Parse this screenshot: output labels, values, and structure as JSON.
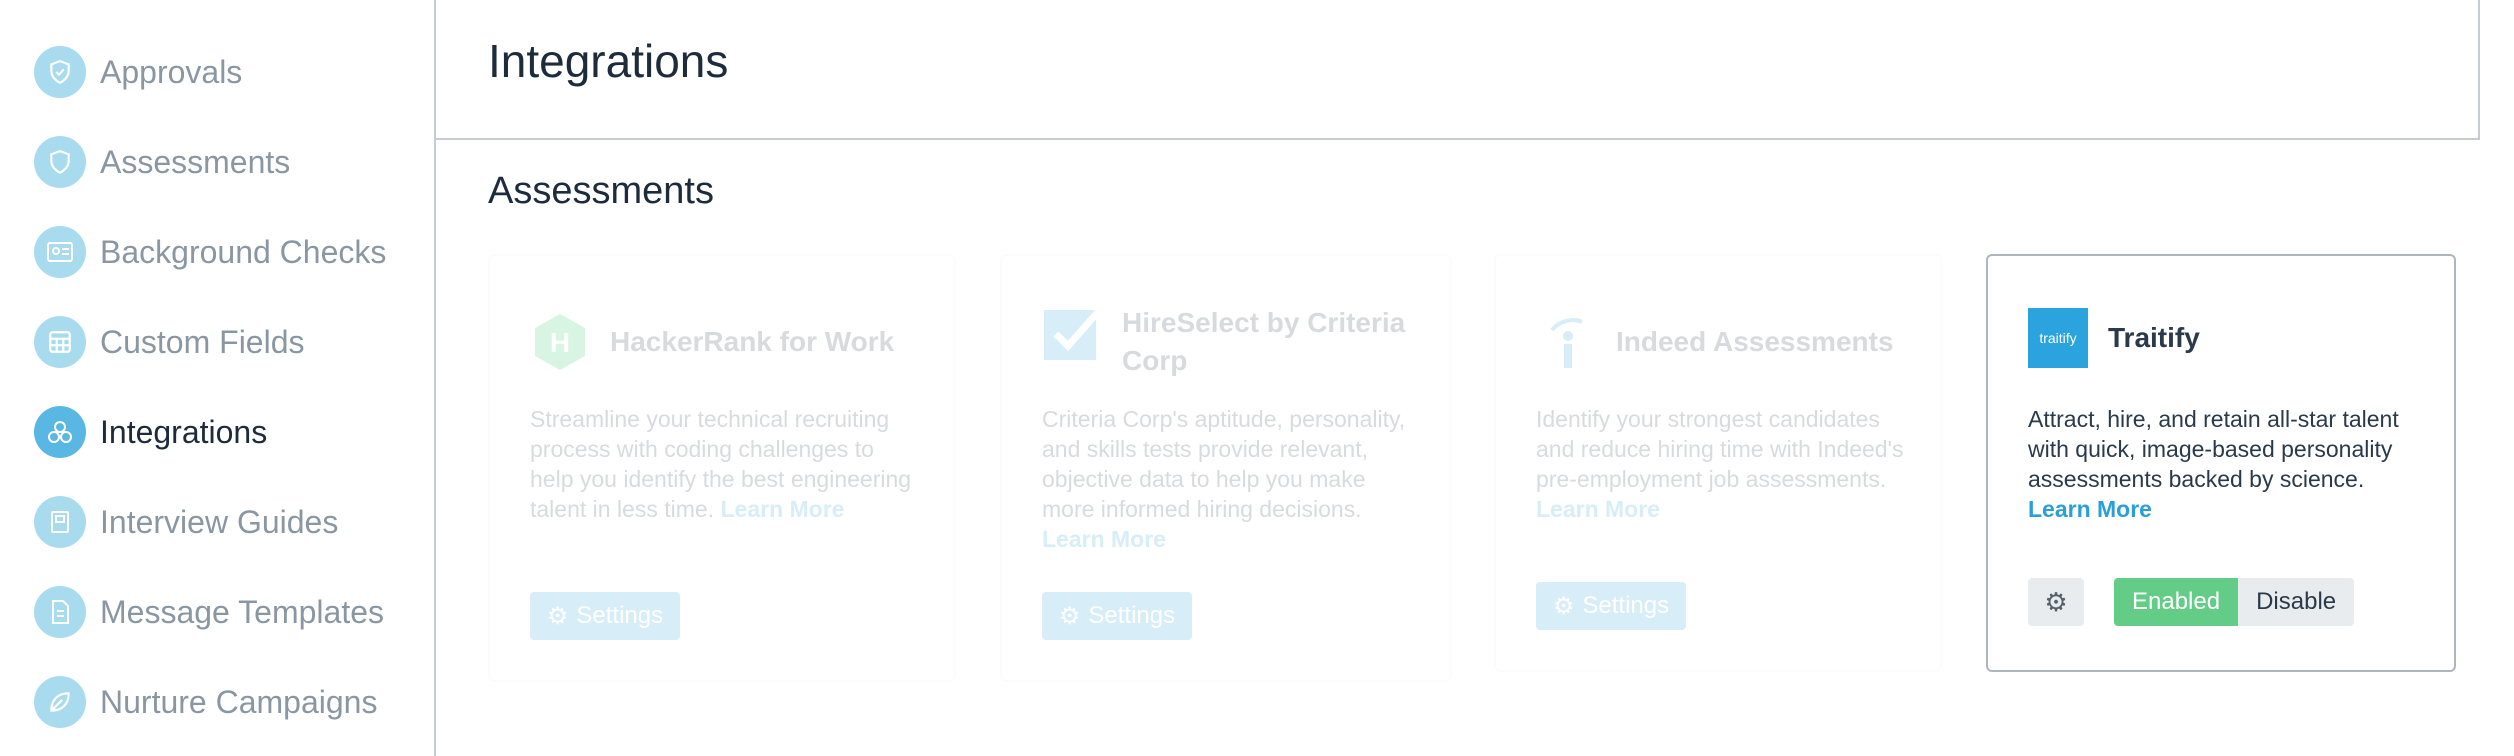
{
  "sidebar": {
    "items": [
      {
        "label": "Approvals",
        "icon": "shield-check-icon",
        "active": false
      },
      {
        "label": "Assessments",
        "icon": "shield-icon",
        "active": false
      },
      {
        "label": "Background Checks",
        "icon": "id-card-icon",
        "active": false
      },
      {
        "label": "Custom Fields",
        "icon": "grid-icon",
        "active": false
      },
      {
        "label": "Integrations",
        "icon": "cubes-icon",
        "active": true
      },
      {
        "label": "Interview Guides",
        "icon": "book-icon",
        "active": false
      },
      {
        "label": "Message Templates",
        "icon": "document-icon",
        "active": false
      },
      {
        "label": "Nurture Campaigns",
        "icon": "leaf-icon",
        "active": false
      }
    ]
  },
  "header": {
    "title": "Integrations"
  },
  "section": {
    "title": "Assessments"
  },
  "cards": [
    {
      "name": "HackerRank for Work",
      "description": "Streamline your technical recruiting process with coding challenges to help you identify the best engineering talent in less time.",
      "learn_more": "Learn More",
      "button": "Settings",
      "state": "disabled"
    },
    {
      "name": "HireSelect by Criteria Corp",
      "description": "Criteria Corp's aptitude, personality, and skills tests provide relevant, objective data to help you make more informed hiring decisions.",
      "learn_more": "Learn More",
      "button": "Settings",
      "state": "disabled"
    },
    {
      "name": "Indeed Assessments",
      "description": "Identify your strongest candidates and reduce hiring time with Indeed's pre-employment job assessments.",
      "learn_more": "Learn More",
      "button": "Settings",
      "state": "disabled"
    },
    {
      "name": "Traitify",
      "logo_text": "traitify",
      "description": "Attract, hire, and retain all-star talent with quick, image-based personality assessments backed by science.",
      "learn_more": "Learn More",
      "enabled_label": "Enabled",
      "disable_label": "Disable",
      "state": "enabled"
    }
  ],
  "colors": {
    "accent": "#2a9fd8",
    "enabled": "#63cd88",
    "sidebar_icon": "#a9dbef",
    "sidebar_icon_active": "#59b8e3",
    "hackerrank": "#2ec866",
    "traitify": "#2aa3de"
  }
}
